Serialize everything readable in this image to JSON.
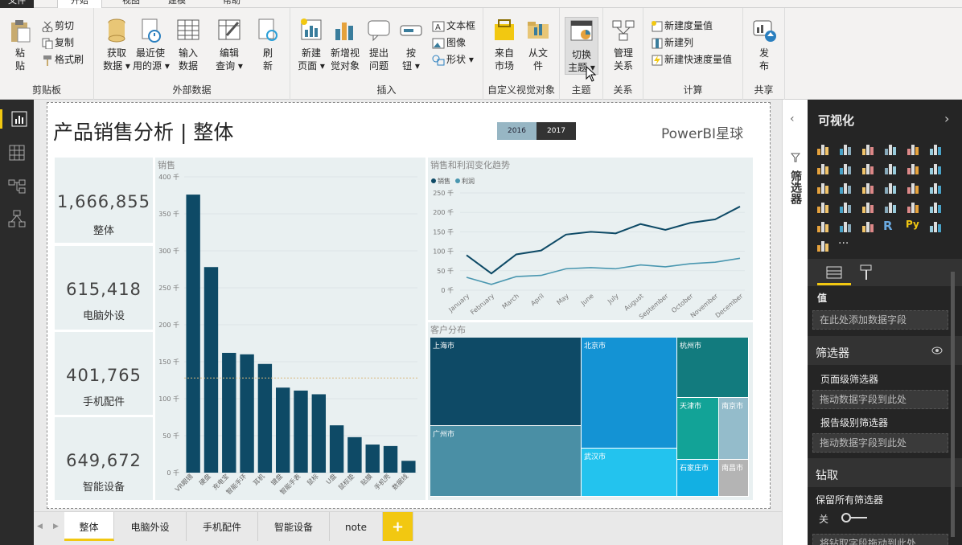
{
  "tabs": [
    "文件",
    "开始",
    "视图",
    "建模",
    "帮助"
  ],
  "ribbon": {
    "clipboard": {
      "paste": "粘\n贴",
      "cut": "剪切",
      "copy": "复制",
      "format": "格式刷",
      "title": "剪贴板"
    },
    "external": {
      "get": "获取\n数据 ▾",
      "recent": "最近使\n用的源 ▾",
      "enter": "输入\n数据",
      "edit": "编辑\n查询 ▾",
      "refresh": "刷\n新",
      "title": "外部数据"
    },
    "insert": {
      "newpage": "新建\n页面 ▾",
      "newvisual": "新增视\n觉对象",
      "ask": "提出\n问题",
      "button": "按\n钮 ▾",
      "textbox": "文本框",
      "image": "图像",
      "shape": "形状 ▾",
      "title": "插入"
    },
    "custom": {
      "market": "来自\n市场",
      "file": "从文\n件",
      "title": "自定义视觉对象"
    },
    "theme": {
      "switch": "切换\n主题 ▾",
      "title": "主题"
    },
    "relations": {
      "manage": "管理\n关系",
      "title": "关系"
    },
    "calc": {
      "measure": "新建度量值",
      "column": "新建列",
      "quick": "新建快速度量值",
      "title": "计算"
    },
    "share": {
      "publish": "发\n布",
      "title": "共享"
    }
  },
  "report": {
    "title": "产品销售分析 | 整体",
    "brand": "PowerBI星球",
    "years": [
      "2016",
      "2017"
    ],
    "kpis": [
      {
        "value": "1,666,855",
        "label": "整体"
      },
      {
        "value": "615,418",
        "label": "电脑外设"
      },
      {
        "value": "401,765",
        "label": "手机配件"
      },
      {
        "value": "649,672",
        "label": "智能设备"
      }
    ]
  },
  "chart_data": [
    {
      "type": "bar",
      "title": "销售",
      "categories": [
        "VR眼镜",
        "硬盘",
        "充电宝",
        "智能手环",
        "耳机",
        "键盘",
        "智能手表",
        "鼠标",
        "U盘",
        "鼠标垫",
        "贴膜",
        "手机壳",
        "数据线"
      ],
      "values": [
        376,
        278,
        162,
        160,
        147,
        115,
        111,
        106,
        64,
        48,
        38,
        36,
        16
      ],
      "ylim": [
        0,
        400
      ],
      "yticks": [
        "0 千",
        "50 千",
        "100 千",
        "150 千",
        "200 千",
        "250 千",
        "300 千",
        "350 千",
        "400 千"
      ],
      "average_line": 128,
      "color": "#0e4a66"
    },
    {
      "type": "line",
      "title": "销售和利润变化趋势",
      "x": [
        "January",
        "February",
        "March",
        "April",
        "May",
        "June",
        "July",
        "August",
        "September",
        "October",
        "November",
        "December"
      ],
      "series": [
        {
          "name": "销售",
          "values": [
            90,
            43,
            92,
            102,
            143,
            150,
            146,
            170,
            155,
            173,
            182,
            215
          ],
          "color": "#0e4a66"
        },
        {
          "name": "利润",
          "values": [
            33,
            15,
            35,
            38,
            55,
            58,
            55,
            65,
            60,
            68,
            72,
            82
          ],
          "color": "#4a97b0"
        }
      ],
      "ylim": [
        0,
        250
      ],
      "yticks": [
        "0 千",
        "50 千",
        "100 千",
        "150 千",
        "200 千",
        "250 千"
      ]
    },
    {
      "type": "treemap",
      "title": "客户分布",
      "items": [
        {
          "name": "上海市",
          "color": "#0e4a66"
        },
        {
          "name": "广州市",
          "color": "#4a8fa5"
        },
        {
          "name": "北京市",
          "color": "#1493d4"
        },
        {
          "name": "武汉市",
          "color": "#23c3ee"
        },
        {
          "name": "杭州市",
          "color": "#127b7e"
        },
        {
          "name": "天津市",
          "color": "#12a397"
        },
        {
          "name": "石家庄市",
          "color": "#12b0e3"
        },
        {
          "name": "南京市",
          "color": "#94bccb"
        },
        {
          "name": "南昌市",
          "color": "#b4b4b4"
        }
      ]
    }
  ],
  "pages": [
    "整体",
    "电脑外设",
    "手机配件",
    "智能设备",
    "note",
    "+"
  ],
  "filters_strip": "筛选器",
  "viz": {
    "title": "可视化",
    "values_label": "值",
    "values_placeholder": "在此处添加数据字段",
    "filters_title": "筛选器",
    "page_filter": "页面级筛选器",
    "page_drop": "拖动数据字段到此处",
    "report_filter": "报告级别筛选器",
    "report_drop": "拖动数据字段到此处",
    "drill_title": "钻取",
    "keep_filters": "保留所有筛选器",
    "toggle": "关",
    "drill_drop": "将钻取字段拖动到此处"
  }
}
